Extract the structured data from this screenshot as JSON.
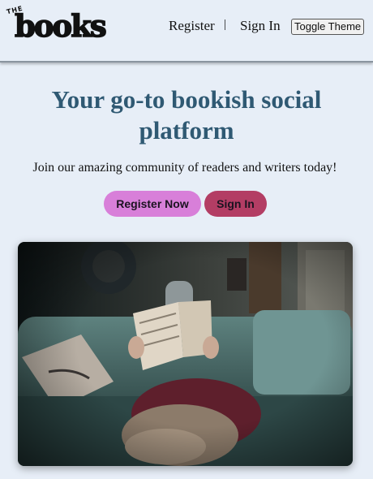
{
  "header": {
    "logo_small": "THE",
    "logo_main": "books",
    "nav": {
      "register": "Register",
      "separator": "|",
      "sign_in": "Sign In"
    },
    "toggle_theme": "Toggle Theme"
  },
  "hero": {
    "title": "Your go-to bookish social platform",
    "subtitle": "Join our amazing community of readers and writers today!",
    "register_button": "Register Now",
    "sign_in_button": "Sign In"
  },
  "colors": {
    "background": "#e7eef7",
    "title": "#2f5973",
    "register_button": "#d87fd9",
    "sign_in_button": "#b33d64"
  }
}
